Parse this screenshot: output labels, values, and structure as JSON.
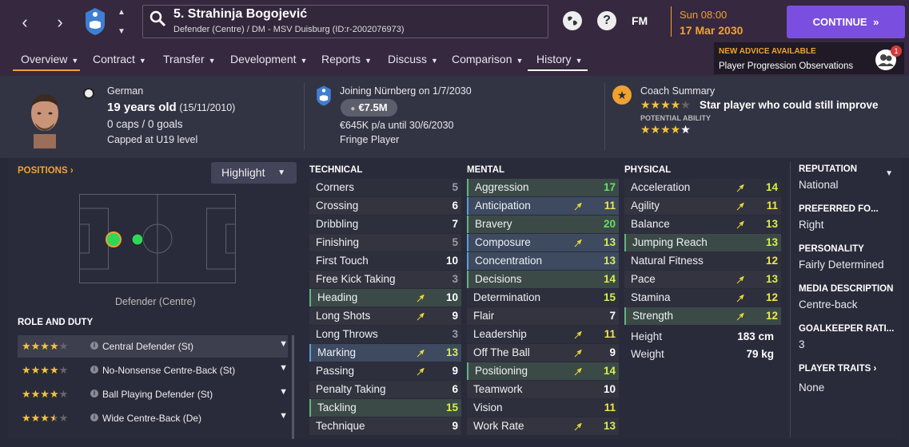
{
  "nav": {
    "back": "‹",
    "forward": "›"
  },
  "player": {
    "title": "5. Strahinja Bogojević",
    "subtitle": "Defender (Centre) / DM - MSV Duisburg (ID:r-2002076973)"
  },
  "header": {
    "fm_label": "FM",
    "help": "?",
    "day": "Sun 08:00",
    "date": "17 Mar 2030",
    "continue_label": "CONTINUE",
    "continue_icon": "»"
  },
  "tabs": [
    {
      "label": "Overview"
    },
    {
      "label": "Contract"
    },
    {
      "label": "Transfer"
    },
    {
      "label": "Development"
    },
    {
      "label": "Reports"
    },
    {
      "label": "Discuss"
    },
    {
      "label": "Comparison"
    },
    {
      "label": "History"
    }
  ],
  "advice": {
    "title": "NEW ADVICE AVAILABLE",
    "text": "Player Progression Observations",
    "count": "1"
  },
  "info": {
    "nationality": "German",
    "age": "19 years old",
    "dob": "(15/11/2010)",
    "caps": "0 caps / 0 goals",
    "capped": "Capped at U19 level",
    "joining": "Joining Nürnberg on 1/7/2030",
    "value": "€7.5M",
    "wage": "€645K p/a until 30/6/2030",
    "status": "Fringe Player",
    "coach_title": "Coach Summary",
    "coach_summary": "Star player who could still improve",
    "coach_stars": 3.5,
    "potential_label": "POTENTIAL ABILITY",
    "potential_stars": 4.5
  },
  "positions": {
    "header": "POSITIONS ›",
    "highlight": "Highlight",
    "position_name": "Defender (Centre)"
  },
  "roles": {
    "header": "ROLE AND DUTY",
    "items": [
      {
        "stars": 4,
        "label": "Central Defender (St)"
      },
      {
        "stars": 4,
        "label": "No-Nonsense Centre-Back (St)"
      },
      {
        "stars": 4,
        "label": "Ball Playing Defender (St)"
      },
      {
        "stars": 3.5,
        "label": "Wide Centre-Back (De)"
      }
    ]
  },
  "technical": {
    "header": "TECHNICAL",
    "attrs": [
      {
        "name": "Corners",
        "value": "5",
        "arrow": false,
        "hl": ""
      },
      {
        "name": "Crossing",
        "value": "6",
        "arrow": false,
        "hl": ""
      },
      {
        "name": "Dribbling",
        "value": "7",
        "arrow": false,
        "hl": ""
      },
      {
        "name": "Finishing",
        "value": "5",
        "arrow": false,
        "hl": ""
      },
      {
        "name": "First Touch",
        "value": "10",
        "arrow": false,
        "hl": ""
      },
      {
        "name": "Free Kick Taking",
        "value": "3",
        "arrow": false,
        "hl": ""
      },
      {
        "name": "Heading",
        "value": "10",
        "arrow": true,
        "hl": "g"
      },
      {
        "name": "Long Shots",
        "value": "9",
        "arrow": true,
        "hl": ""
      },
      {
        "name": "Long Throws",
        "value": "3",
        "arrow": false,
        "hl": ""
      },
      {
        "name": "Marking",
        "value": "13",
        "arrow": true,
        "hl": "b"
      },
      {
        "name": "Passing",
        "value": "9",
        "arrow": true,
        "hl": ""
      },
      {
        "name": "Penalty Taking",
        "value": "6",
        "arrow": false,
        "hl": ""
      },
      {
        "name": "Tackling",
        "value": "15",
        "arrow": false,
        "hl": "g"
      },
      {
        "name": "Technique",
        "value": "9",
        "arrow": false,
        "hl": ""
      }
    ]
  },
  "mental": {
    "header": "MENTAL",
    "attrs": [
      {
        "name": "Aggression",
        "value": "17",
        "arrow": false,
        "hl": "g"
      },
      {
        "name": "Anticipation",
        "value": "11",
        "arrow": true,
        "hl": "b"
      },
      {
        "name": "Bravery",
        "value": "20",
        "arrow": false,
        "hl": "g"
      },
      {
        "name": "Composure",
        "value": "13",
        "arrow": true,
        "hl": "b"
      },
      {
        "name": "Concentration",
        "value": "13",
        "arrow": false,
        "hl": "b"
      },
      {
        "name": "Decisions",
        "value": "14",
        "arrow": false,
        "hl": "g"
      },
      {
        "name": "Determination",
        "value": "15",
        "arrow": false,
        "hl": ""
      },
      {
        "name": "Flair",
        "value": "7",
        "arrow": false,
        "hl": ""
      },
      {
        "name": "Leadership",
        "value": "11",
        "arrow": true,
        "hl": ""
      },
      {
        "name": "Off The Ball",
        "value": "9",
        "arrow": true,
        "hl": ""
      },
      {
        "name": "Positioning",
        "value": "14",
        "arrow": true,
        "hl": "g"
      },
      {
        "name": "Teamwork",
        "value": "10",
        "arrow": false,
        "hl": ""
      },
      {
        "name": "Vision",
        "value": "11",
        "arrow": false,
        "hl": ""
      },
      {
        "name": "Work Rate",
        "value": "13",
        "arrow": true,
        "hl": ""
      }
    ]
  },
  "physical": {
    "header": "PHYSICAL",
    "attrs": [
      {
        "name": "Acceleration",
        "value": "14",
        "arrow": true,
        "hl": ""
      },
      {
        "name": "Agility",
        "value": "11",
        "arrow": true,
        "hl": ""
      },
      {
        "name": "Balance",
        "value": "13",
        "arrow": true,
        "hl": ""
      },
      {
        "name": "Jumping Reach",
        "value": "13",
        "arrow": false,
        "hl": "g"
      },
      {
        "name": "Natural Fitness",
        "value": "12",
        "arrow": false,
        "hl": ""
      },
      {
        "name": "Pace",
        "value": "13",
        "arrow": true,
        "hl": ""
      },
      {
        "name": "Stamina",
        "value": "12",
        "arrow": true,
        "hl": ""
      },
      {
        "name": "Strength",
        "value": "12",
        "arrow": true,
        "hl": "g"
      }
    ],
    "height_label": "Height",
    "height": "183 cm",
    "weight_label": "Weight",
    "weight": "79 kg"
  },
  "side": {
    "reputation_label": "REPUTATION",
    "reputation": "National",
    "foot_label": "PREFERRED FO...",
    "foot": "Right",
    "personality_label": "PERSONALITY",
    "personality": "Fairly Determined",
    "media_label": "MEDIA DESCRIPTION",
    "media": "Centre-back",
    "gk_label": "GOALKEEPER RATI...",
    "gk": "3",
    "traits_label": "PLAYER TRAITS ›",
    "traits": "None"
  }
}
